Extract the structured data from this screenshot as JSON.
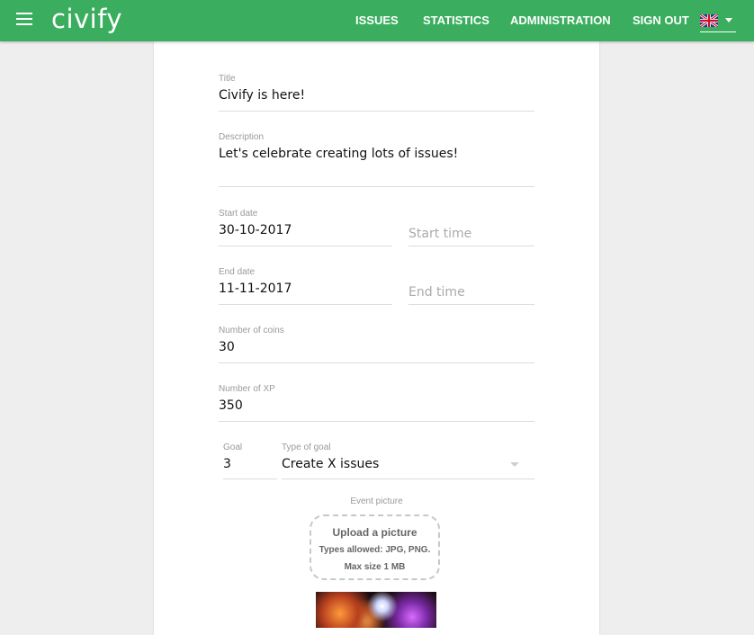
{
  "appbar": {
    "logo": "civify",
    "nav": [
      "ISSUES",
      "STATISTICS",
      "ADMINISTRATION",
      "SIGN OUT"
    ],
    "language_icon": "uk-flag-icon",
    "brand_color": "#3aae5e"
  },
  "form": {
    "title": {
      "label": "Title",
      "value": "Civify is here!"
    },
    "description": {
      "label": "Description",
      "value": "Let's celebrate creating lots of issues!"
    },
    "start_date": {
      "label": "Start date",
      "value": "30-10-2017"
    },
    "start_time": {
      "placeholder": "Start time"
    },
    "end_date": {
      "label": "End date",
      "value": "11-11-2017"
    },
    "end_time": {
      "placeholder": "End time"
    },
    "coins": {
      "label": "Number of coins",
      "value": "30"
    },
    "xp": {
      "label": "Number of XP",
      "value": "350"
    },
    "goal": {
      "label": "Goal",
      "value": "3"
    },
    "goal_type": {
      "label": "Type of goal",
      "value": "Create X issues"
    }
  },
  "upload": {
    "label": "Event picture",
    "title": "Upload a picture",
    "types": "Types allowed: JPG, PNG.",
    "max_size": "Max size 1 MB"
  }
}
